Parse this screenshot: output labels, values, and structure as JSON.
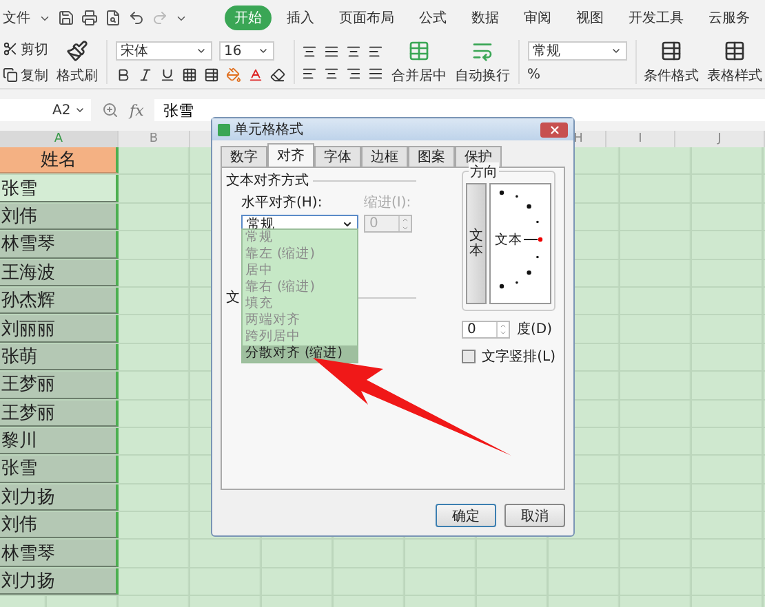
{
  "menu_bar": {
    "file": "文件",
    "tabs": [
      {
        "label": "开始",
        "selected": true
      },
      {
        "label": "插入",
        "selected": false
      },
      {
        "label": "页面布局",
        "selected": false
      },
      {
        "label": "公式",
        "selected": false
      },
      {
        "label": "数据",
        "selected": false
      },
      {
        "label": "审阅",
        "selected": false
      },
      {
        "label": "视图",
        "selected": false
      },
      {
        "label": "开发工具",
        "selected": false
      },
      {
        "label": "云服务",
        "selected": false
      }
    ]
  },
  "ribbon": {
    "cut": "剪切",
    "copy": "复制",
    "format_painter": "格式刷",
    "font_name": "宋体",
    "font_size": "16",
    "merge": "合并居中",
    "wrap": "自动换行",
    "number_format": "常规",
    "percent": "%",
    "conditional_format": "条件格式",
    "table_style": "表格样式"
  },
  "formula_bar": {
    "cell": "A2",
    "fx": "fx",
    "value": "张雪"
  },
  "sheet": {
    "columns": [
      {
        "label": "A",
        "selected": true
      },
      {
        "label": "B",
        "selected": false
      },
      {
        "label": "H",
        "selected": false
      },
      {
        "label": "I",
        "selected": false
      },
      {
        "label": "J",
        "selected": false
      }
    ],
    "header_cell": "姓名",
    "rows": [
      {
        "name": "张雪",
        "active": true
      },
      {
        "name": "刘伟",
        "active": false
      },
      {
        "name": "林雪琴",
        "active": false
      },
      {
        "name": "王海波",
        "active": false
      },
      {
        "name": "孙杰辉",
        "active": false
      },
      {
        "name": "刘丽丽",
        "active": false
      },
      {
        "name": "张萌",
        "active": false
      },
      {
        "name": "王梦丽",
        "active": false
      },
      {
        "name": "王梦丽",
        "active": false
      },
      {
        "name": "黎川",
        "active": false
      },
      {
        "name": "张雪",
        "active": false
      },
      {
        "name": "刘力扬",
        "active": false
      },
      {
        "name": "刘伟",
        "active": false
      },
      {
        "name": "林雪琴",
        "active": false
      },
      {
        "name": "刘力扬",
        "active": false
      }
    ]
  },
  "dialog": {
    "title": "单元格格式",
    "tabs": [
      {
        "label": "数字",
        "selected": false
      },
      {
        "label": "对齐",
        "selected": true
      },
      {
        "label": "字体",
        "selected": false
      },
      {
        "label": "边框",
        "selected": false
      },
      {
        "label": "图案",
        "selected": false
      },
      {
        "label": "保护",
        "selected": false
      }
    ],
    "section_title": "文本对齐方式",
    "horizontal_label": "水平对齐(H):",
    "horizontal_value": "常规",
    "indent_label": "缩进(I):",
    "indent_value": "0",
    "indent_disabled": true,
    "options": [
      {
        "label": "常规",
        "selected": false
      },
      {
        "label": "靠左 (缩进)",
        "selected": false
      },
      {
        "label": "居中",
        "selected": false
      },
      {
        "label": "靠右 (缩进)",
        "selected": false
      },
      {
        "label": "填充",
        "selected": false
      },
      {
        "label": "两端对齐",
        "selected": false
      },
      {
        "label": "跨列居中",
        "selected": false
      },
      {
        "label": "分散对齐 (缩进)",
        "selected": true
      }
    ],
    "hidden_section_fragment": "文",
    "orientation": {
      "title": "方向",
      "vertical_button": "文本",
      "dial_text": "文本",
      "degrees_value": "0",
      "degrees_label": "度(D)",
      "vertical_text_label": "文字竖排(L)",
      "vertical_text_checked": false
    },
    "buttons": [
      {
        "label": "确定",
        "default": true
      },
      {
        "label": "取消",
        "default": false
      }
    ]
  }
}
